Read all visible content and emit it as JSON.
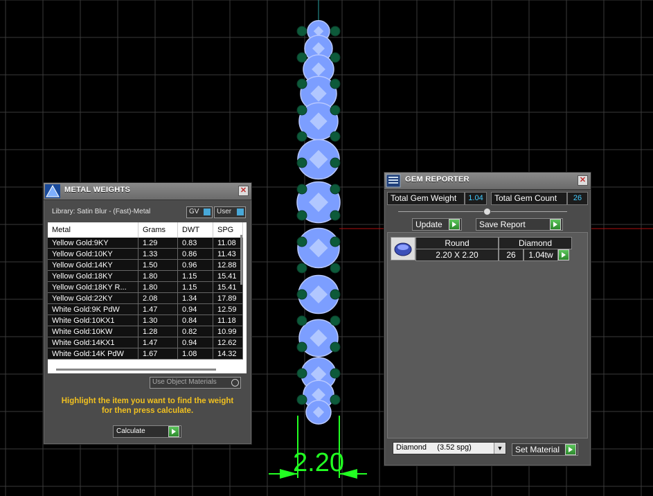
{
  "viewport": {
    "dimension_label": "2.20",
    "colors": {
      "grid": "#3a3a3a",
      "gem": "#88aaff",
      "bead": "#0d5a3a",
      "dimension": "#22ff22",
      "axis_red": "#b01010",
      "axis_teal": "#2aa0a0"
    }
  },
  "metal_weights": {
    "title": "METAL WEIGHTS",
    "library": "Library: Satin Blur - (Fast)-Metal",
    "toggle_gv": "GV",
    "toggle_user": "User",
    "columns": [
      "Metal",
      "Grams",
      "DWT",
      "SPG"
    ],
    "rows": [
      [
        "Yellow Gold:9KY",
        "1.29",
        "0.83",
        "11.08"
      ],
      [
        "Yellow Gold:10KY",
        "1.33",
        "0.86",
        "11.43"
      ],
      [
        "Yellow Gold:14KY",
        "1.50",
        "0.96",
        "12.88"
      ],
      [
        "Yellow Gold:18KY",
        "1.80",
        "1.15",
        "15.41"
      ],
      [
        "Yellow Gold:18KY R...",
        "1.80",
        "1.15",
        "15.41"
      ],
      [
        "Yellow Gold:22KY",
        "2.08",
        "1.34",
        "17.89"
      ],
      [
        "White Gold:9K PdW",
        "1.47",
        "0.94",
        "12.59"
      ],
      [
        "White Gold:10KX1",
        "1.30",
        "0.84",
        "11.18"
      ],
      [
        "White Gold:10KW",
        "1.28",
        "0.82",
        "10.99"
      ],
      [
        "White Gold:14KX1",
        "1.47",
        "0.94",
        "12.62"
      ],
      [
        "White Gold:14K PdW",
        "1.67",
        "1.08",
        "14.32"
      ]
    ],
    "use_object_materials": "Use Object Materials",
    "hint": "Highlight the item you want to find the weight for then press calculate.",
    "calculate": "Calculate"
  },
  "gem_reporter": {
    "title": "GEM REPORTER",
    "total_weight_label": "Total Gem Weight",
    "total_weight_value": "1.04",
    "total_count_label": "Total Gem Count",
    "total_count_value": "26",
    "update": "Update",
    "save_report": "Save Report",
    "gem": {
      "shape": "Round",
      "material": "Diamond",
      "size": "2.20 X 2.20",
      "count": "26",
      "weight": "1.04tw"
    },
    "material_select": "Diamond     (3.52 spg)",
    "set_material": "Set Material"
  }
}
